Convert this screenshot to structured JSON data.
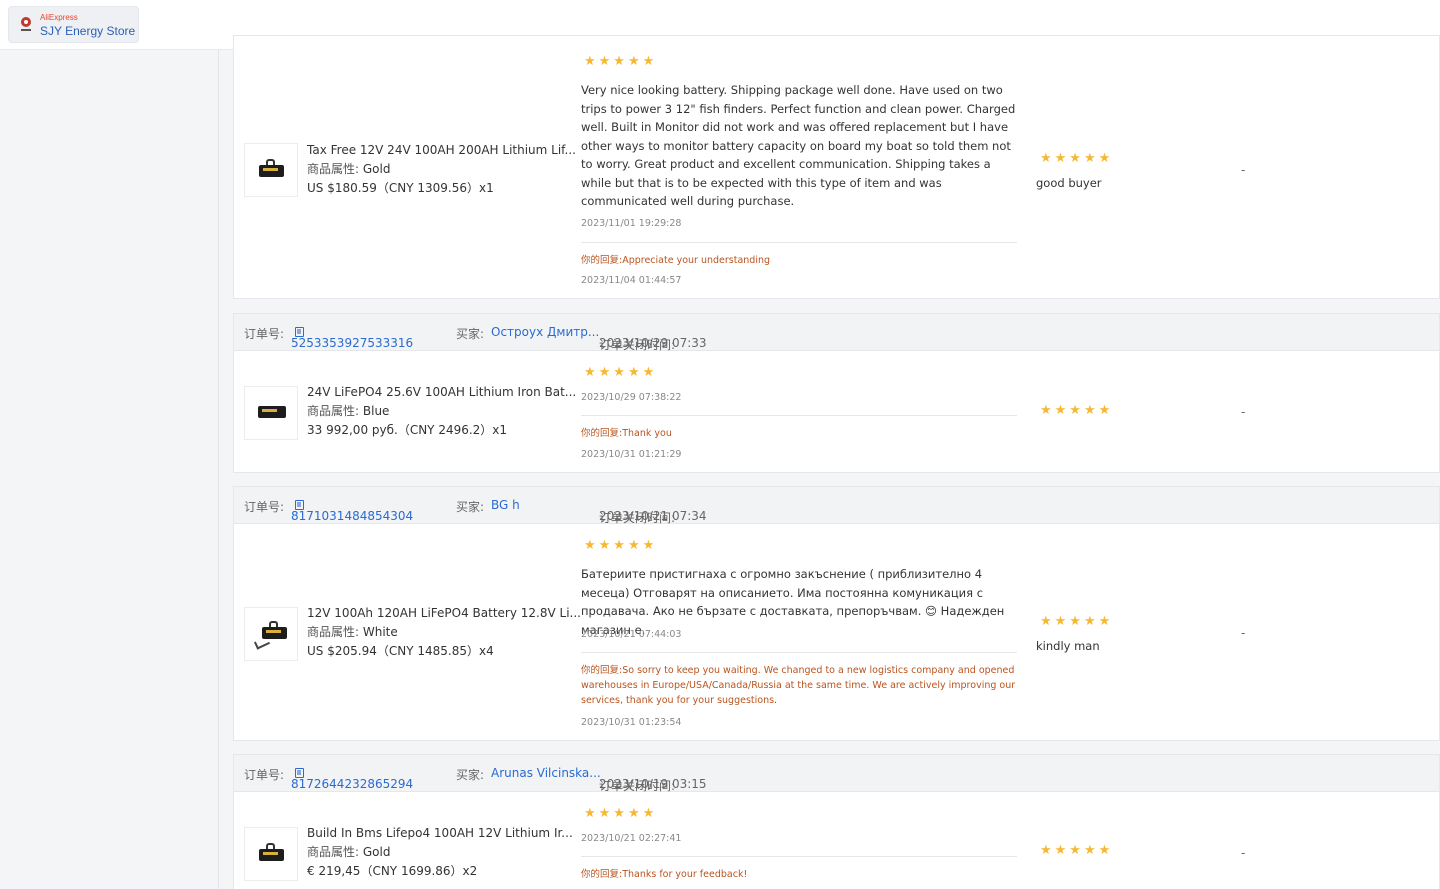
{
  "store": {
    "platform": "AliExpress",
    "name": "SJY Energy Store"
  },
  "labels": {
    "order_no": "订单号:",
    "buyer": "买家:",
    "closed_time": "订单关闭时间:",
    "attr": "商品属性:",
    "reply": "你的回复:"
  },
  "stars_text": "★★★★★",
  "orders": [
    {
      "product_title": "Tax Free 12V 24V 100AH 200AH Lithium Lif...",
      "attribute": "Gold",
      "price": "US $180.59（CNY  1309.56）x1",
      "rating": 5,
      "review": "Very nice looking battery. Shipping package well done. Have used on two trips to power 3 12\" fish finders. Perfect function and clean power. Charged well. Built in Monitor did not work and was offered replacement but I have other ways to monitor battery capacity on board my boat so told them not to worry. Great product and excellent communication. Shipping takes a while but that is to be expected with this type of item and was communicated well during purchase.",
      "review_time": "2023/11/01 19:29:28",
      "reply": "Appreciate your understanding",
      "reply_time": "2023/11/04 01:44:57",
      "seller_rating": 5,
      "seller_comment": "good buyer",
      "extra": "-"
    },
    {
      "order_id": "5253353927533316",
      "buyer": "Остроух Дмитр...",
      "closed_time": "2023/10/29 07:33",
      "product_title": "24V LiFePO4 25.6V 100AH Lithium Iron Bat...",
      "attribute": "Blue",
      "price": "33 992,00 руб.（CNY  2496.2）x1",
      "rating": 5,
      "review": "",
      "review_time": "2023/10/29 07:38:22",
      "reply": "Thank you",
      "reply_time": "2023/10/31 01:21:29",
      "seller_rating": 5,
      "seller_comment": "",
      "extra": "-"
    },
    {
      "order_id": "8171031484854304",
      "buyer": "BG h",
      "closed_time": "2023/10/21 07:34",
      "product_title": "12V 100Ah 120AH LiFePO4 Battery 12.8V Li...",
      "attribute": "White",
      "price": "US $205.94（CNY  1485.85）x4",
      "rating": 5,
      "review": "Батериите пристигнаха с огромно закъснение ( приблизително 4 месеца) Отговарят на описанието. Има постоянна комуникация с продавача. Ако не бързате с доставката, препоръчвам. 😊 Надежден магазин е.",
      "review_time": "2023/10/21 07:44:03",
      "reply": "So sorry to keep you waiting. We changed to a new logistics company and opened warehouses in Europe/USA/Canada/Russia at the same time. We are actively improving our services, thank you for your suggestions.",
      "reply_time": "2023/10/31 01:23:54",
      "seller_rating": 5,
      "seller_comment": "kindly man",
      "extra": "-"
    },
    {
      "order_id": "8172644232865294",
      "buyer": "Arunas Vilcinska...",
      "closed_time": "2023/10/19 03:15",
      "product_title": "Build In Bms Lifepo4 100AH 12V Lithium Ir...",
      "attribute": "Gold",
      "price": "€ 219,45（CNY  1699.86）x2",
      "rating": 5,
      "review": "",
      "review_time": "2023/10/21 02:27:41",
      "reply": "Thanks for your feedback!",
      "reply_time": "",
      "seller_rating": 5,
      "seller_comment": "",
      "extra": "-"
    }
  ]
}
